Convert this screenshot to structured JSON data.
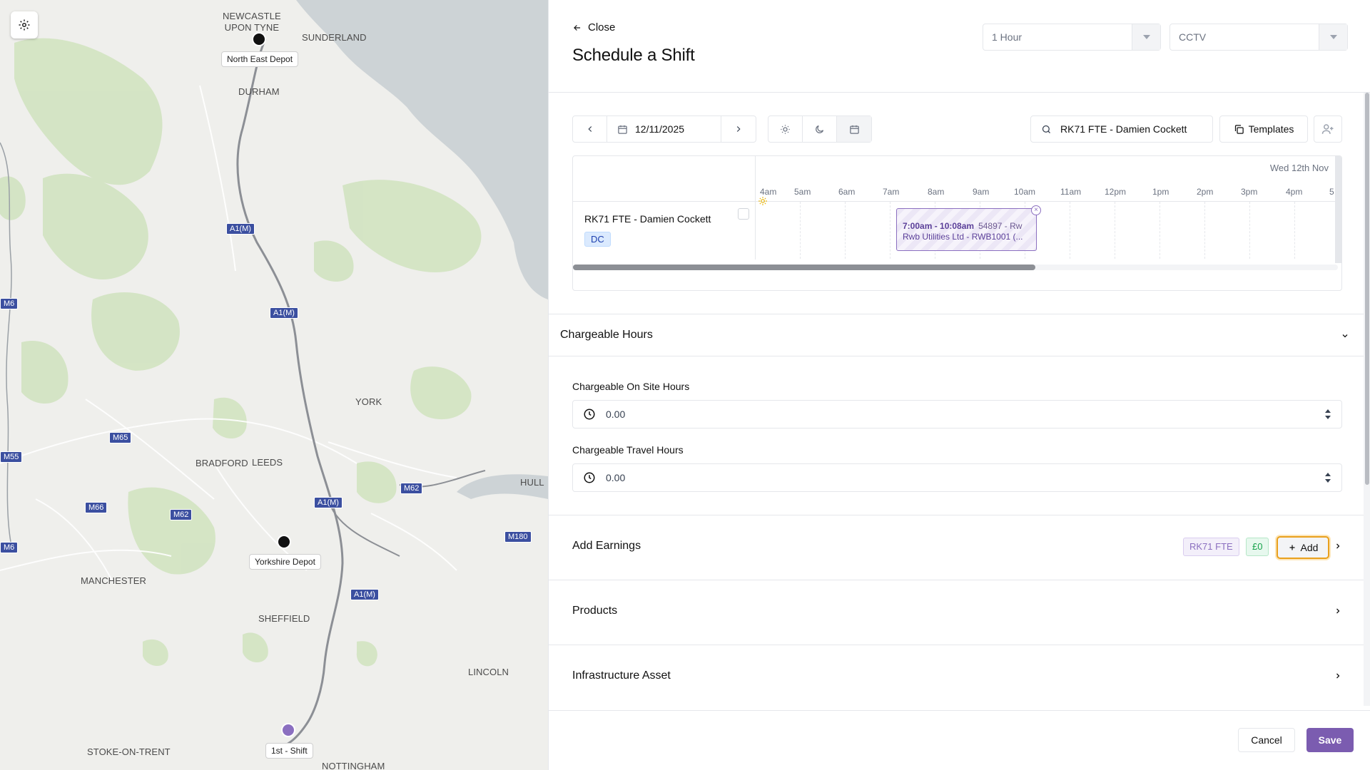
{
  "map": {
    "settings_icon": "gear-icon",
    "cities": [
      {
        "name": "NEWCASTLE\nUPON TYNE"
      },
      {
        "name": "SUNDERLAND"
      },
      {
        "name": "DURHAM"
      },
      {
        "name": "YORK"
      },
      {
        "name": "BRADFORD"
      },
      {
        "name": "LEEDS"
      },
      {
        "name": "HULL"
      },
      {
        "name": "MANCHESTER"
      },
      {
        "name": "SHEFFIELD"
      },
      {
        "name": "LINCOLN"
      },
      {
        "name": "STOKE-ON-TRENT"
      },
      {
        "name": "NOTTINGHAM"
      }
    ],
    "roads": [
      "A1(M)",
      "A1(M)",
      "A1(M)",
      "A1(M)",
      "M6",
      "M65",
      "M55",
      "M66",
      "M62",
      "M62",
      "M6",
      "M180"
    ],
    "markers": [
      {
        "label": "North East Depot",
        "color": "#111111"
      },
      {
        "label": "Yorkshire Depot",
        "color": "#111111"
      },
      {
        "label": "1st - Shift",
        "color": "#8b6fc0"
      }
    ]
  },
  "header": {
    "close_label": "Close",
    "title": "Schedule a Shift",
    "duration_select": "1 Hour",
    "type_select": "CCTV"
  },
  "toolbar": {
    "date": "12/11/2025",
    "search_value": "RK71 FTE - Damien Cockett",
    "templates_label": "Templates"
  },
  "timeline": {
    "day_label": "Wed 12th Nov",
    "hours": [
      "4am",
      "5am",
      "6am",
      "7am",
      "8am",
      "9am",
      "10am",
      "11am",
      "12pm",
      "1pm",
      "2pm",
      "3pm",
      "4pm",
      "5"
    ],
    "worker": {
      "name": "RK71 FTE - Damien Cockett",
      "badge": "DC"
    },
    "shift": {
      "time": "7:00am - 10:08am",
      "ref": "54897 - Rw",
      "client": "Rwb Utilities Ltd - RWB1001 (..."
    }
  },
  "chargeable": {
    "title": "Chargeable Hours",
    "onsite_label": "Chargeable On Site Hours",
    "onsite_value": "0.00",
    "travel_label": "Chargeable Travel Hours",
    "travel_value": "0.00"
  },
  "earnings": {
    "title": "Add Earnings",
    "pill_vehicle": "RK71 FTE",
    "pill_amount": "£0",
    "add_label": "Add"
  },
  "products": {
    "title": "Products"
  },
  "infrastructure": {
    "title": "Infrastructure Asset"
  },
  "footer": {
    "cancel_label": "Cancel",
    "save_label": "Save"
  },
  "colors": {
    "accent": "#7b5cb0",
    "shift_purple": "#8b6fc0",
    "highlight_orange": "#e9a01d",
    "road_blue": "#3b4fa0",
    "green_area": "#d3e4c3"
  }
}
